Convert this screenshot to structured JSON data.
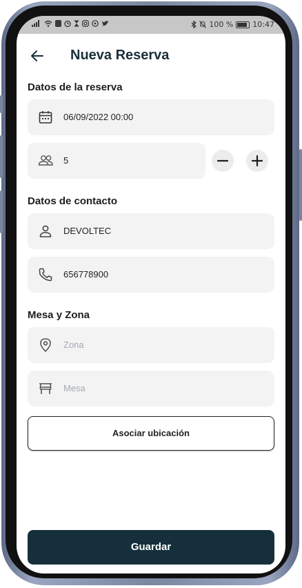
{
  "status_bar": {
    "left_icons": [
      "signal-icon",
      "wifi-icon",
      "nfc-icon",
      "alarm-icon",
      "hourglass-icon",
      "instagram-icon",
      "whatsapp-icon",
      "twitter-icon"
    ],
    "bluetooth": "bluetooth-icon",
    "mute": "mute-icon",
    "battery_percent": "100 %",
    "time": "10:47"
  },
  "header": {
    "title": "Nueva Reserva",
    "back_icon": "arrow-left-icon"
  },
  "reservation": {
    "section_title": "Datos de la reserva",
    "datetime": "06/09/2022 00:00",
    "guests": "5"
  },
  "contact": {
    "section_title": "Datos de contacto",
    "name": "DEVOLTEC",
    "phone": "656778900"
  },
  "table_zone": {
    "section_title": "Mesa y Zona",
    "zone_placeholder": "Zona",
    "table_placeholder": "Mesa",
    "associate_button": "Asociar ubicación"
  },
  "footer": {
    "save_button": "Guardar"
  },
  "colors": {
    "primary": "#15303b",
    "field_bg": "#f3f3f3",
    "placeholder": "#a3a9b4"
  }
}
